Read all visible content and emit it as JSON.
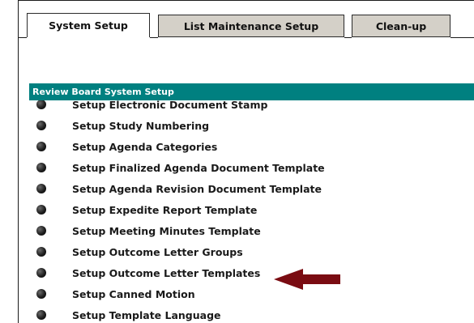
{
  "tabs": [
    {
      "label": "System Setup",
      "active": true
    },
    {
      "label": "List Maintenance Setup",
      "active": false
    },
    {
      "label": "Clean-up",
      "active": false
    }
  ],
  "section": {
    "title": "Review Board System Setup",
    "items": [
      {
        "label": "Setup Electronic Document Stamp"
      },
      {
        "label": "Setup Study Numbering"
      },
      {
        "label": "Setup Agenda Categories"
      },
      {
        "label": "Setup Finalized Agenda Document Template"
      },
      {
        "label": "Setup Agenda Revision Document Template"
      },
      {
        "label": "Setup Expedite Report Template"
      },
      {
        "label": "Setup Meeting Minutes Template"
      },
      {
        "label": "Setup Outcome Letter Groups"
      },
      {
        "label": "Setup Outcome Letter Templates"
      },
      {
        "label": "Setup Canned Motion"
      },
      {
        "label": "Setup Template Language"
      }
    ]
  },
  "annotation": {
    "arrow_color": "#7a0c12",
    "points_to": "Setup Outcome Letter Templates"
  },
  "colors": {
    "header_bg": "#008080",
    "inactive_tab_bg": "#d4d0c8"
  }
}
